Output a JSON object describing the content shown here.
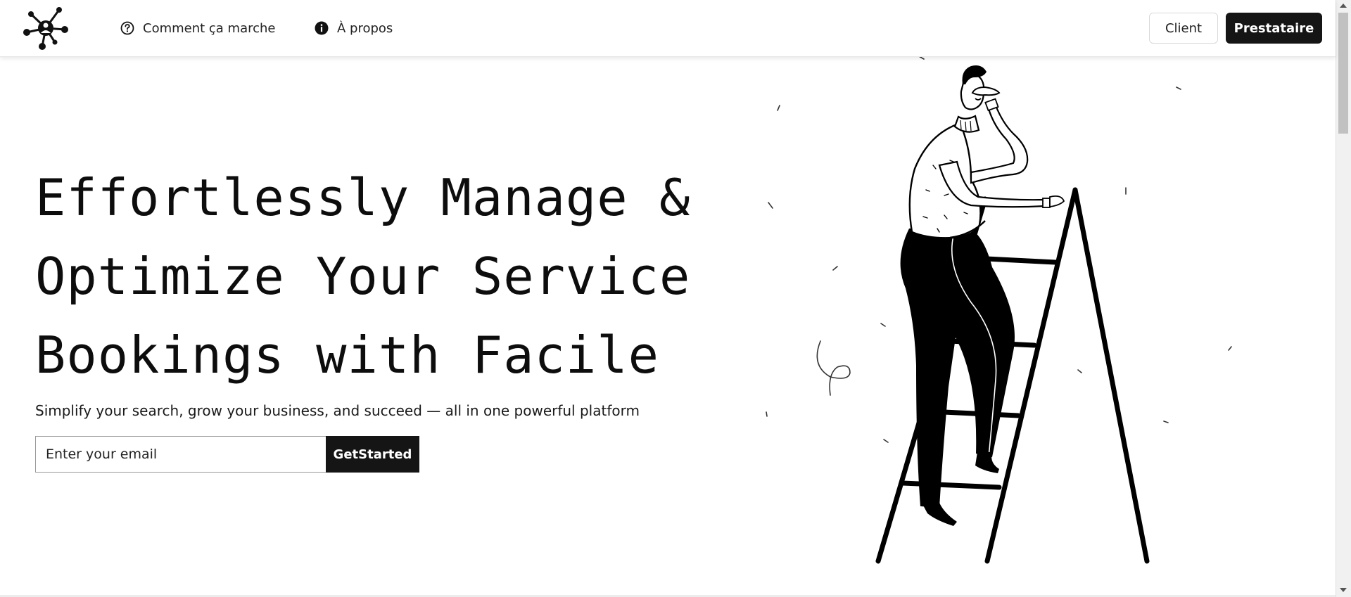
{
  "header": {
    "logo_icon": "network-people-icon",
    "nav": [
      {
        "label": "Comment ça marche",
        "icon": "question-circle-icon"
      },
      {
        "label": "À propos",
        "icon": "info-circle-icon"
      }
    ],
    "client_label": "Client",
    "prestataire_label": "Prestataire"
  },
  "hero": {
    "title_lines": [
      "Effortlessly Manage &",
      "Optimize Your Service",
      "Bookings with Facile"
    ],
    "subtitle": "Simplify your search, grow your business, and succeed — all in one powerful platform",
    "email_placeholder": "Enter your email",
    "cta_label": "GetStarted",
    "illustration_icon": "man-on-ladder-illustration"
  },
  "colors": {
    "primary_dark": "#151515",
    "background": "#ffffff",
    "border": "#d9d9d9"
  }
}
